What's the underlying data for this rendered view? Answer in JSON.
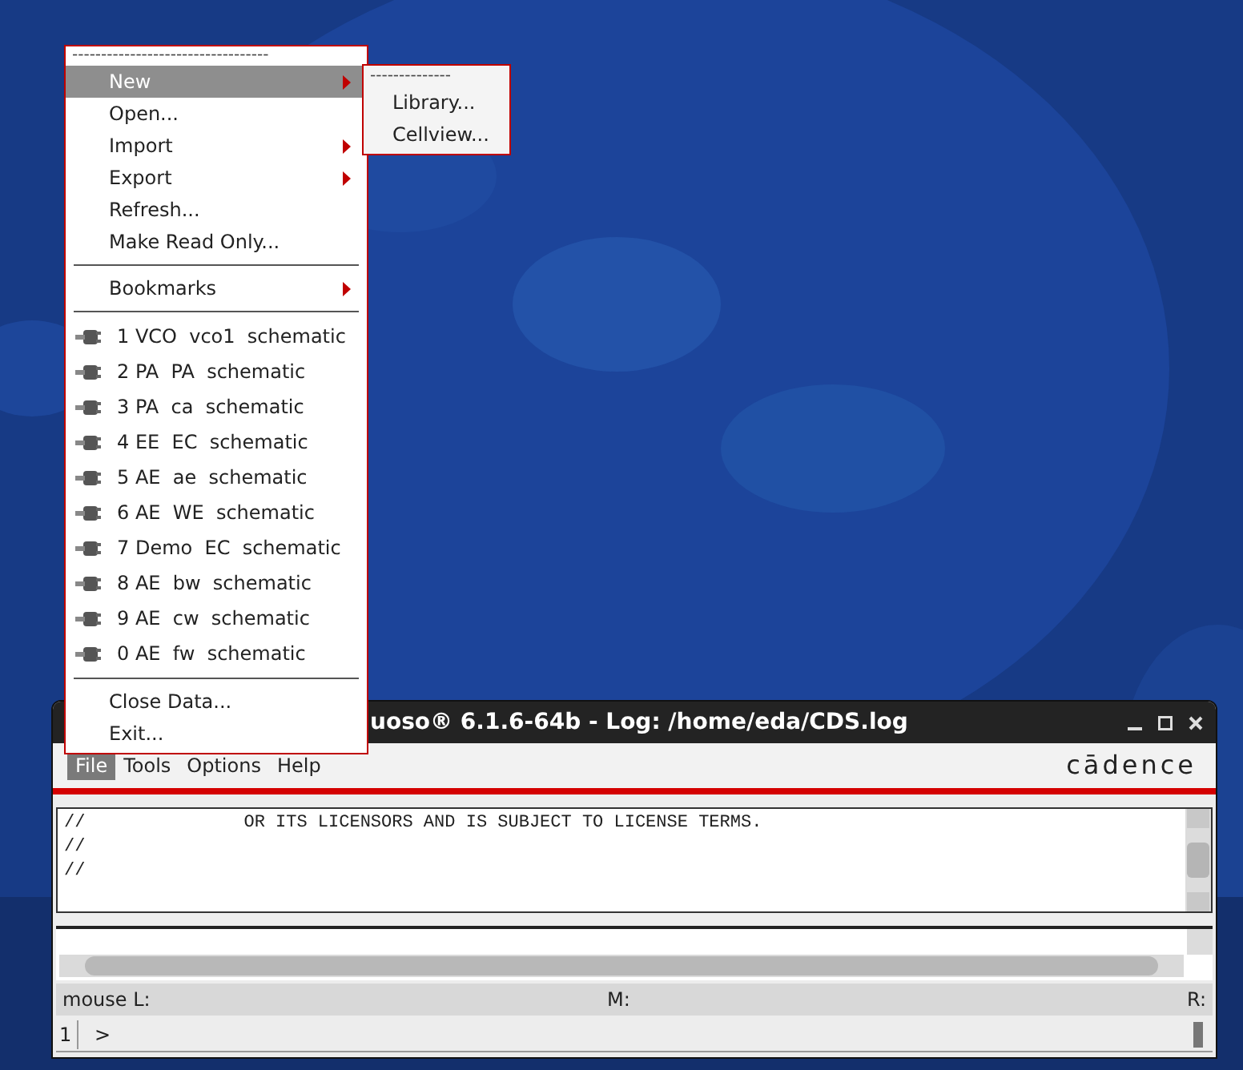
{
  "menu": {
    "tearoff": "----------------------------------",
    "items": [
      {
        "kind": "item",
        "label": "New",
        "submenu": true,
        "selected": true
      },
      {
        "kind": "item",
        "label": "Open...",
        "submenu": false,
        "selected": false
      },
      {
        "kind": "item",
        "label": "Import",
        "submenu": true,
        "selected": false
      },
      {
        "kind": "item",
        "label": "Export",
        "submenu": true,
        "selected": false
      },
      {
        "kind": "item",
        "label": "Refresh...",
        "submenu": false,
        "selected": false
      },
      {
        "kind": "item",
        "label": "Make Read Only...",
        "submenu": false,
        "selected": false
      },
      {
        "kind": "separator"
      },
      {
        "kind": "item",
        "label": "Bookmarks",
        "submenu": true,
        "selected": false
      },
      {
        "kind": "separator"
      },
      {
        "kind": "recent",
        "label": "1 VCO  vco1  schematic",
        "selected": false
      },
      {
        "kind": "recent",
        "label": "2 PA  PA  schematic",
        "selected": false
      },
      {
        "kind": "recent",
        "label": "3 PA  ca  schematic",
        "selected": false
      },
      {
        "kind": "recent",
        "label": "4 EE  EC  schematic",
        "selected": false
      },
      {
        "kind": "recent",
        "label": "5 AE  ae  schematic",
        "selected": false
      },
      {
        "kind": "recent",
        "label": "6 AE  WE  schematic",
        "selected": false
      },
      {
        "kind": "recent",
        "label": "7 Demo  EC  schematic",
        "selected": false
      },
      {
        "kind": "recent",
        "label": "8 AE  bw  schematic",
        "selected": false
      },
      {
        "kind": "recent",
        "label": "9 AE  cw  schematic",
        "selected": false
      },
      {
        "kind": "recent",
        "label": "0 AE  fw  schematic",
        "selected": false
      },
      {
        "kind": "separator"
      },
      {
        "kind": "item",
        "label": "Close Data...",
        "submenu": false,
        "selected": false
      },
      {
        "kind": "item",
        "label": "Exit...",
        "submenu": false,
        "selected": false
      }
    ]
  },
  "submenu": {
    "tearoff": "--------------",
    "items": [
      {
        "label": "Library..."
      },
      {
        "label": "Cellview..."
      }
    ]
  },
  "window": {
    "title": "uoso® 6.1.6-64b - Log: /home/eda/CDS.log",
    "menubar": [
      {
        "label": "File",
        "selected": true
      },
      {
        "label": "Tools",
        "selected": false
      },
      {
        "label": "Options",
        "selected": false
      },
      {
        "label": "Help",
        "selected": false
      }
    ],
    "logo": "cādence",
    "log_lines": [
      "//               OR ITS LICENSORS AND IS SUBJECT TO LICENSE TERMS.",
      "//",
      "//"
    ],
    "status_bar": {
      "left": "mouse L:",
      "middle": "M:",
      "right": "R:"
    },
    "command": {
      "line_number": "1",
      "prompt": ">"
    }
  }
}
